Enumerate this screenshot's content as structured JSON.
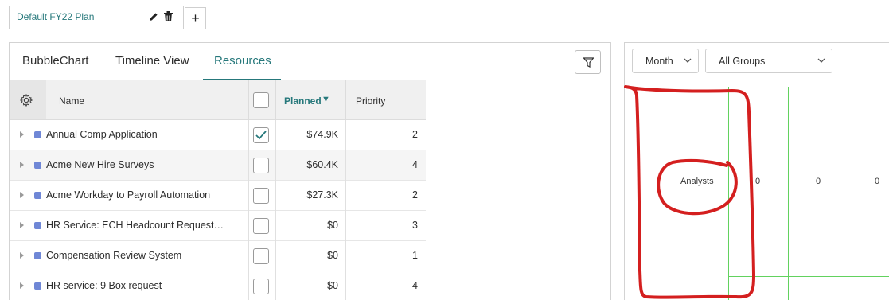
{
  "plan_tab": {
    "label": "Default FY22 Plan",
    "add_label": "+"
  },
  "view_tabs": [
    {
      "label": "BubbleChart"
    },
    {
      "label": "Timeline View"
    },
    {
      "label": "Resources"
    }
  ],
  "active_view_tab": "Resources",
  "grid": {
    "headers": {
      "name": "Name",
      "planned": "Planned",
      "planned_sort": "▼",
      "priority": "Priority"
    },
    "rows": [
      {
        "name": "Annual Comp Application",
        "checked": true,
        "planned": "$74.9K",
        "priority": "2"
      },
      {
        "name": "Acme New Hire Surveys",
        "checked": false,
        "planned": "$60.4K",
        "priority": "4"
      },
      {
        "name": "Acme Workday to Payroll Automation",
        "checked": false,
        "planned": "$27.3K",
        "priority": "2"
      },
      {
        "name": "HR Service: ECH Headcount Request…",
        "checked": false,
        "planned": "$0",
        "priority": "3"
      },
      {
        "name": "Compensation Review System",
        "checked": false,
        "planned": "$0",
        "priority": "1"
      },
      {
        "name": "HR service: 9 Box request",
        "checked": false,
        "planned": "$0",
        "priority": "4"
      }
    ]
  },
  "right_panel": {
    "period_select": "Month",
    "group_select": "All Groups",
    "row_label": "Analysts",
    "values": [
      "0",
      "0",
      "0"
    ]
  },
  "colors": {
    "accent": "#26787b",
    "swatch": "#6f87d6",
    "grid_line": "#62d25e",
    "annotation": "#d41f1f"
  },
  "icons": [
    "pencil-icon",
    "trash-icon",
    "plus-icon",
    "filter-icon",
    "gear-icon",
    "chevron-down-icon",
    "checkmark-icon",
    "expand-arrow-icon"
  ]
}
